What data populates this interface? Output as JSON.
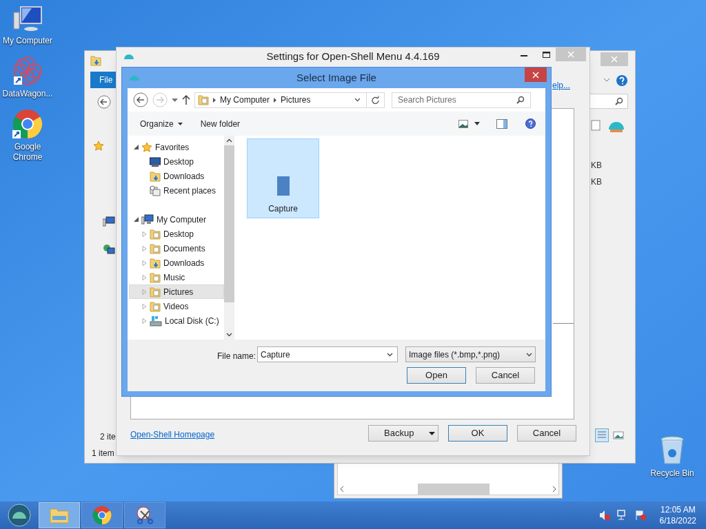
{
  "desktop_icons": [
    {
      "label": "My Computer",
      "kind": "computer"
    },
    {
      "label": "DataWagon...",
      "kind": "datawagon"
    },
    {
      "label": "Google Chrome",
      "kind": "chrome"
    },
    {
      "label": "Recycle Bin",
      "kind": "bin"
    }
  ],
  "explorer_window": {
    "ribbon_tab": "File",
    "size_texts": [
      "KB",
      "KB"
    ],
    "status_count": "2 ite",
    "status_bar": "1 item"
  },
  "settings_window": {
    "title": "Settings for Open-Shell Menu 4.4.169",
    "help_link": "elp...",
    "homepage_link": "Open-Shell Homepage",
    "buttons": [
      {
        "label": "Backup",
        "kind": "split"
      },
      {
        "label": "OK",
        "kind": "default"
      },
      {
        "label": "Cancel",
        "kind": "normal"
      }
    ]
  },
  "dialog": {
    "title": "Select Image File",
    "breadcrumb": [
      "My Computer",
      "Pictures"
    ],
    "search": {
      "placeholder": "Search Pictures"
    },
    "toolbar": [
      "Organize",
      "New folder"
    ],
    "nav_tree": [
      {
        "label": "Favorites",
        "kind": "star",
        "expanded": true,
        "selected": false,
        "children": [
          {
            "label": "Desktop",
            "kind": "desktop",
            "expandable": false,
            "selected": false
          },
          {
            "label": "Downloads",
            "kind": "downloads",
            "expandable": false,
            "selected": false
          },
          {
            "label": "Recent places",
            "kind": "recent",
            "expandable": false,
            "selected": false
          }
        ]
      },
      {
        "label": "My Computer",
        "kind": "computer",
        "expanded": true,
        "selected": false,
        "children": [
          {
            "label": "Desktop",
            "kind": "folder",
            "expandable": true,
            "selected": false
          },
          {
            "label": "Documents",
            "kind": "folder",
            "expandable": true,
            "selected": false
          },
          {
            "label": "Downloads",
            "kind": "downloads",
            "expandable": true,
            "selected": false
          },
          {
            "label": "Music",
            "kind": "folder",
            "expandable": true,
            "selected": false
          },
          {
            "label": "Pictures",
            "kind": "folder",
            "expandable": true,
            "selected": true
          },
          {
            "label": "Videos",
            "kind": "folder",
            "expandable": true,
            "selected": false
          },
          {
            "label": "Local Disk (C:)",
            "kind": "disk",
            "expandable": true,
            "selected": false
          }
        ]
      }
    ],
    "files": [
      {
        "name": "Capture",
        "selected": true
      }
    ],
    "file_name": {
      "label": "File name:",
      "value": "Capture"
    },
    "file_type": "Image files (*.bmp,*.png)",
    "buttons": [
      {
        "label": "Open",
        "kind": "default"
      },
      {
        "label": "Cancel",
        "kind": "normal"
      }
    ]
  },
  "taskbar": {
    "apps": [
      {
        "kind": "explorer",
        "selected": true
      },
      {
        "kind": "chrome",
        "selected": false
      },
      {
        "kind": "snip",
        "selected": false
      }
    ],
    "time": "12:05 AM",
    "date": "6/18/2022"
  }
}
